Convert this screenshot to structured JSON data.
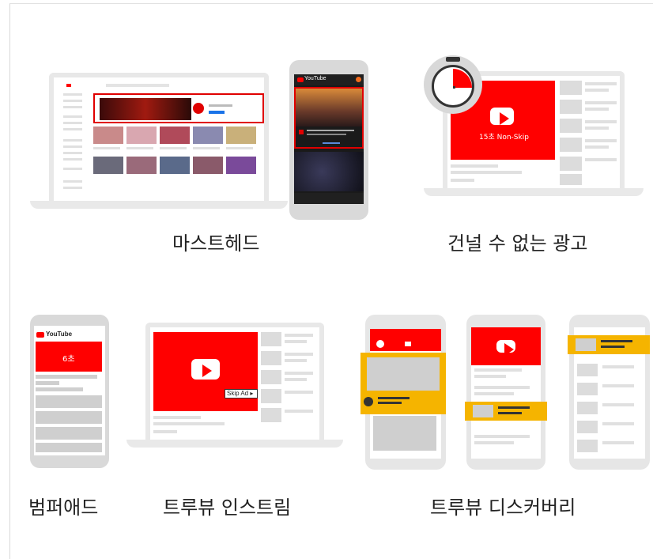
{
  "captions": {
    "masthead": "마스트헤드",
    "non_skip": "건널 수 없는 광고",
    "bumper": "범퍼애드",
    "instream": "트루뷰 인스트림",
    "discovery": "트루뷰 디스커버리"
  },
  "labels": {
    "non_skip_video": "15초 Non-Skip",
    "bumper_video": "6초",
    "youtube_logo": "YouTube",
    "skip_ad": "Skip Ad ▸"
  },
  "colors": {
    "brand_red": "#ff0000",
    "highlight_yellow": "#f5b400"
  }
}
